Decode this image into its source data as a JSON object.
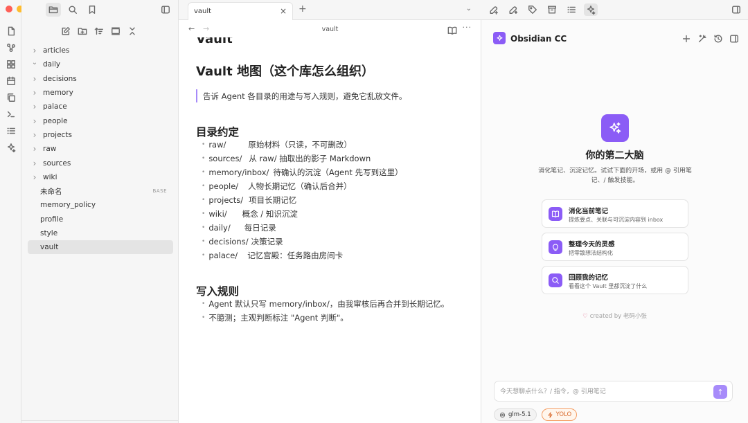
{
  "colors": {
    "accent": "#8b5cf6",
    "accent_light": "#a78bfa",
    "traffic_red": "#fe5f57",
    "traffic_yellow": "#febc2e",
    "traffic_green": "#28c840",
    "yolo_orange": "#d9692b"
  },
  "ribbon": {
    "icons": [
      "file-icon",
      "graph-icon",
      "grid-icon",
      "calendar-icon",
      "copy-icon",
      "terminal-icon",
      "list-icon",
      "sparkle-icon"
    ]
  },
  "explorer": {
    "top_icons": [
      "folder-icon",
      "search-icon",
      "bookmark-icon",
      "sidebar-toggle-icon"
    ],
    "tool_icons": [
      "new-note-icon",
      "new-folder-icon",
      "sort-icon",
      "collapse-icon",
      "close-all-icon"
    ],
    "items": [
      {
        "label": "articles",
        "type": "folder",
        "state": "collapsed"
      },
      {
        "label": "daily",
        "type": "folder",
        "state": "expanded"
      },
      {
        "label": "decisions",
        "type": "folder",
        "state": "collapsed"
      },
      {
        "label": "memory",
        "type": "folder",
        "state": "collapsed"
      },
      {
        "label": "palace",
        "type": "folder",
        "state": "collapsed"
      },
      {
        "label": "people",
        "type": "folder",
        "state": "collapsed"
      },
      {
        "label": "projects",
        "type": "folder",
        "state": "collapsed"
      },
      {
        "label": "raw",
        "type": "folder",
        "state": "collapsed"
      },
      {
        "label": "sources",
        "type": "folder",
        "state": "collapsed"
      },
      {
        "label": "wiki",
        "type": "folder",
        "state": "collapsed"
      },
      {
        "label": "未命名",
        "type": "file",
        "badge": "BASE"
      },
      {
        "label": "memory_policy",
        "type": "file"
      },
      {
        "label": "profile",
        "type": "file"
      },
      {
        "label": "style",
        "type": "file"
      },
      {
        "label": "vault",
        "type": "file",
        "selected": true
      }
    ]
  },
  "editor": {
    "tab_title": "vault",
    "tab_close": "×",
    "new_tab": "+",
    "tab_menu": "⌄",
    "nav_back": "←",
    "nav_forward": "→",
    "breadcrumb": "vault",
    "more": "···",
    "cut_heading": "Vault",
    "heading": "Vault 地图（这个库怎么组织）",
    "quote": "告诉 Agent 各目录的用途与写入规则，避免它乱放文件。",
    "section1_title": "目录约定",
    "section1_items": [
      {
        "key": "raw/",
        "val": "原始材料（只读，不可删改）",
        "gap": 32
      },
      {
        "key": "sources/",
        "val": "从 raw/ 抽取出的影子 Markdown",
        "gap": 10
      },
      {
        "key": "memory/inbox/",
        "val": "待确认的沉淀（Agent 先写到这里）",
        "gap": 6
      },
      {
        "key": "people/",
        "val": "人物长期记忆（确认后合并）",
        "gap": 14
      },
      {
        "key": "projects/",
        "val": "项目长期记忆",
        "gap": 8
      },
      {
        "key": "wiki/",
        "val": "概念 / 知识沉淀",
        "gap": 22
      },
      {
        "key": "daily/",
        "val": "每日记录",
        "gap": 20
      },
      {
        "key": "decisions/",
        "val": "决策记录",
        "gap": 4
      },
      {
        "key": "palace/",
        "val": "记忆宫殿：任务路由房间卡",
        "gap": 14
      }
    ],
    "section2_title": "写入规则",
    "section2_items": [
      "Agent 默认只写 memory/inbox/，由我审核后再合并到长期记忆。",
      "不臆测；主观判断标注 \"Agent 判断\"。"
    ]
  },
  "panel": {
    "top_icons": [
      "plugin-add-icon",
      "plugin-star-icon",
      "tag-icon",
      "archive-icon",
      "outline-icon",
      "sparkle-icon"
    ],
    "title": "Obsidian CC",
    "header_icons": [
      "plus-icon",
      "magic-wand-icon",
      "history-icon",
      "split-view-icon"
    ],
    "plus_label": "+",
    "hero_title": "你的第二大脑",
    "hero_subtitle": "消化笔记、沉淀记忆。试试下面的开场，或用 @ 引用笔记、/ 触发技能。",
    "cards": [
      {
        "icon": "book-icon",
        "title": "消化当前笔记",
        "subtitle": "提炼要点、关联与可沉淀内容到 inbox"
      },
      {
        "icon": "lightbulb-icon",
        "title": "整理今天的灵感",
        "subtitle": "把零散想法结构化"
      },
      {
        "icon": "search-icon",
        "title": "回顾我的记忆",
        "subtitle": "看看这个 Vault 里都沉淀了什么"
      }
    ],
    "credit": "created by 老码小张",
    "credit_heart": "♡",
    "input_placeholder": "今天想聊点什么？/ 指令，@ 引用笔记",
    "send_label": "↑",
    "model_chip": "glm-5.1",
    "yolo_chip": "YOLO"
  }
}
